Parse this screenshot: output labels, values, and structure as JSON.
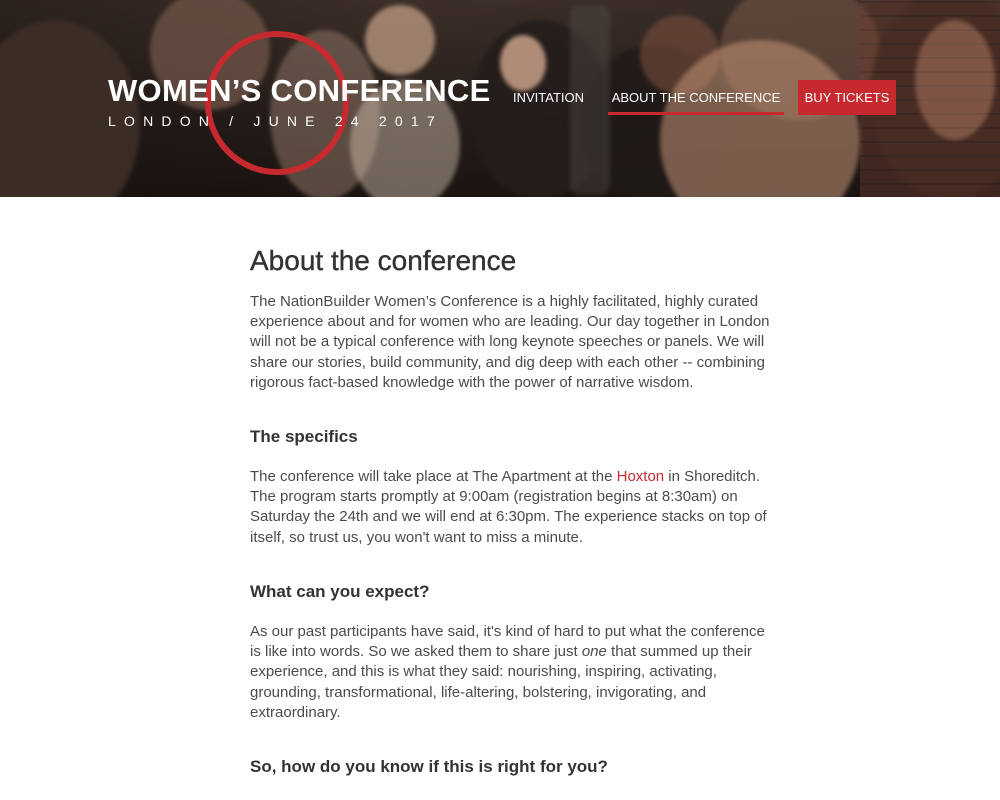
{
  "brand": {
    "title": "WOMEN’S CONFERENCE",
    "subtitle": "LONDON / JUNE 24 2017",
    "accent_color": "#c62a2f"
  },
  "nav": {
    "items": [
      {
        "label": "INVITATION"
      },
      {
        "label": "ABOUT THE CONFERENCE",
        "active": true
      },
      {
        "label": "BUY TICKETS",
        "style": "button"
      }
    ]
  },
  "article": {
    "title": "About the conference",
    "intro": "The NationBuilder Women’s Conference is a highly facilitated, highly curated experience about and for women who are leading. Our day together in London will not be a typical conference with long keynote speeches or panels. We will share our stories, build community, and dig deep with each other -- combining rigorous fact-based knowledge with the power of narrative wisdom.",
    "specifics": {
      "heading": "The specifics",
      "text_before_link": "The conference will take place at The Apartment at the ",
      "link": "Hoxton",
      "text_after_link": " in Shoreditch. The program starts promptly at 9:00am (registration begins at 8:30am) on Saturday the 24th and we will end at 6:30pm. The experience stacks on top of itself, so trust us, you won't want to miss a minute."
    },
    "expect": {
      "heading": "What can you expect?",
      "text_before_em": "As our past participants have said, it's kind of hard to put what the conference is like into words. So we asked them to share just ",
      "em": "one",
      "text_after_em": " that summed up their experience, and this is what they said: nourishing, inspiring, activating, grounding, transformational, life-altering, bolstering, invigorating, and extraordinary."
    },
    "right_for_you": {
      "heading": "So, how do you know if this is right for you?"
    }
  }
}
